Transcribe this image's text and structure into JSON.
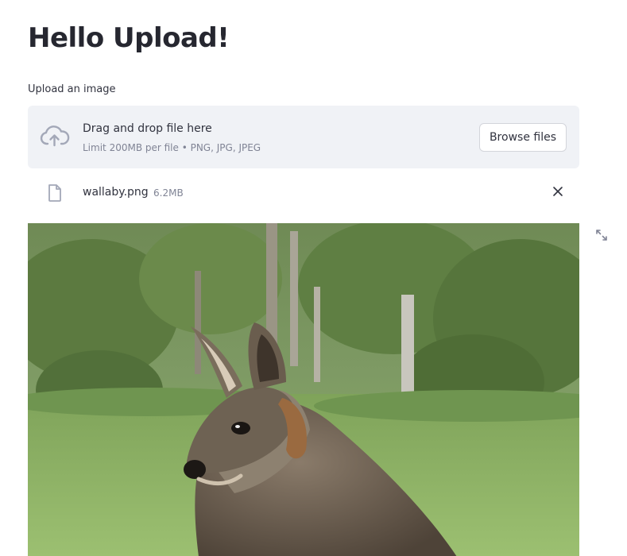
{
  "page": {
    "title": "Hello Upload!"
  },
  "uploader": {
    "label": "Upload an image",
    "drop_text": "Drag and drop file here",
    "limit_text": "Limit 200MB per file • PNG, JPG, JPEG",
    "browse_label": "Browse files",
    "icon": "cloud-upload-icon"
  },
  "file": {
    "name": "wallaby.png",
    "size": "6.2MB",
    "icon": "file-icon",
    "remove_icon": "close-icon"
  },
  "image": {
    "subject": "wallaby",
    "expand_icon": "fullscreen-icon"
  },
  "colors": {
    "dropzone_bg": "#f0f2f6",
    "text": "#31333f",
    "muted": "#808495",
    "icon": "#a3a8b8"
  }
}
